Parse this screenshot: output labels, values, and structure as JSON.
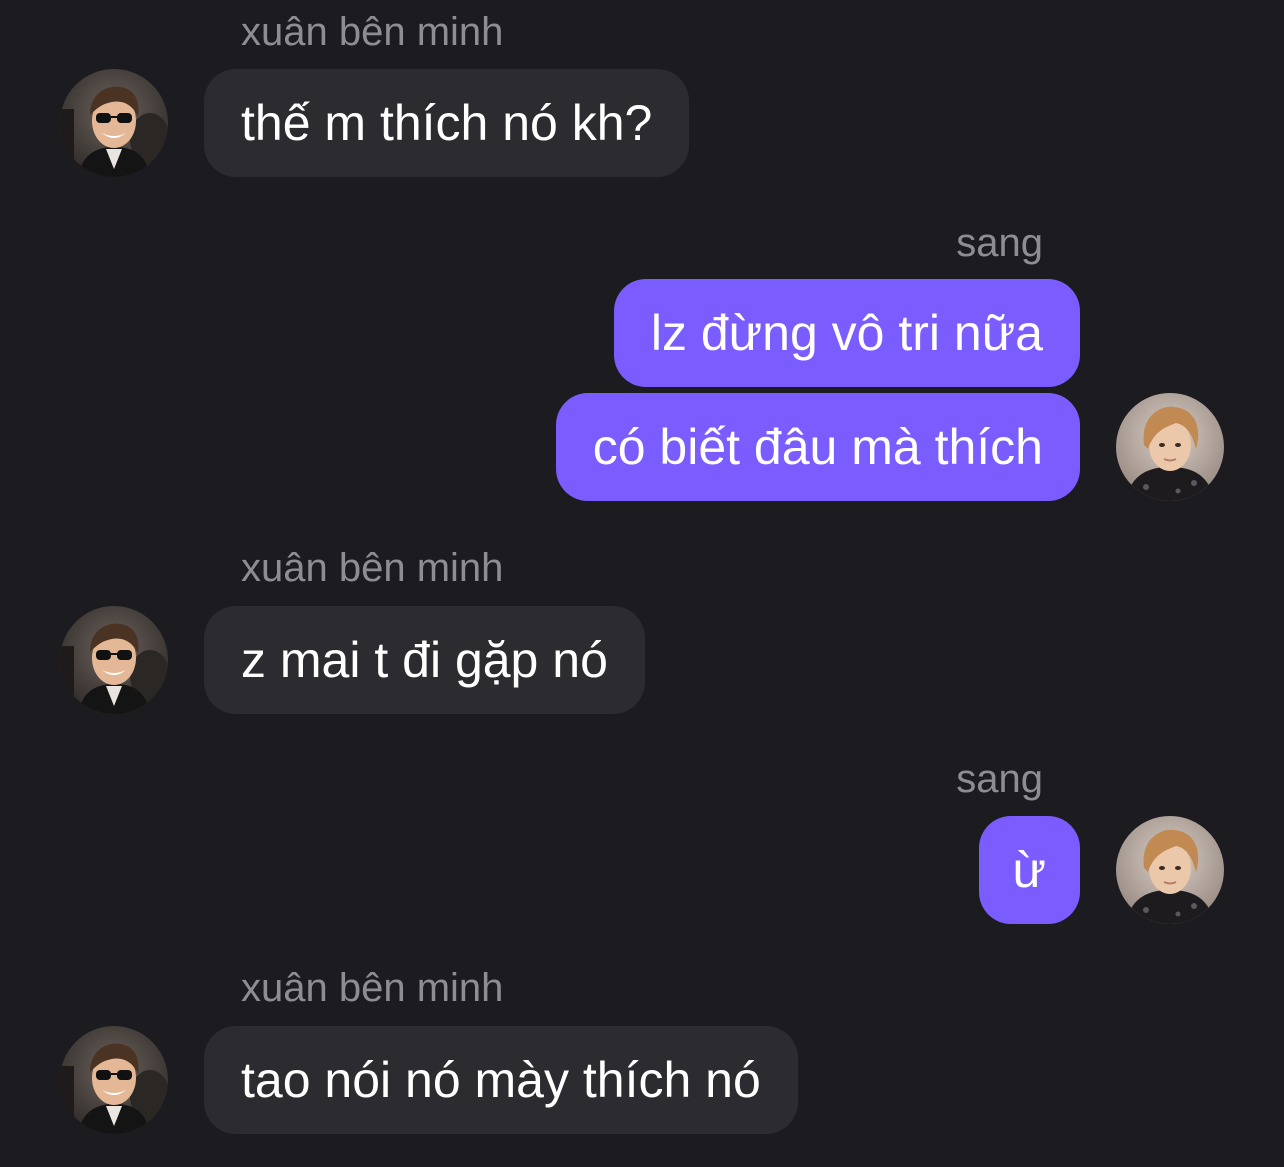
{
  "colors": {
    "background": "#1c1b20",
    "incoming_bubble": "#2c2c30",
    "outgoing_bubble": "#7b5cff",
    "sender_name": "#8e8d93",
    "message_text": "#ffffff"
  },
  "chat": {
    "groups": [
      {
        "sender": "xuân bên minh",
        "direction": "incoming",
        "avatar_icon": "avatar-xuan-photo",
        "messages": [
          "thế m thích nó kh?"
        ]
      },
      {
        "sender": "sang",
        "direction": "outgoing",
        "avatar_icon": "avatar-sang-photo",
        "messages": [
          "lz đừng vô tri nữa",
          "có biết đâu mà thích"
        ]
      },
      {
        "sender": "xuân bên minh",
        "direction": "incoming",
        "avatar_icon": "avatar-xuan-photo",
        "messages": [
          "z mai t đi gặp nó"
        ]
      },
      {
        "sender": "sang",
        "direction": "outgoing",
        "avatar_icon": "avatar-sang-photo",
        "messages": [
          "ừ"
        ]
      },
      {
        "sender": "xuân bên minh",
        "direction": "incoming",
        "avatar_icon": "avatar-xuan-photo",
        "messages": [
          "tao nói nó mày thích nó"
        ]
      }
    ]
  }
}
